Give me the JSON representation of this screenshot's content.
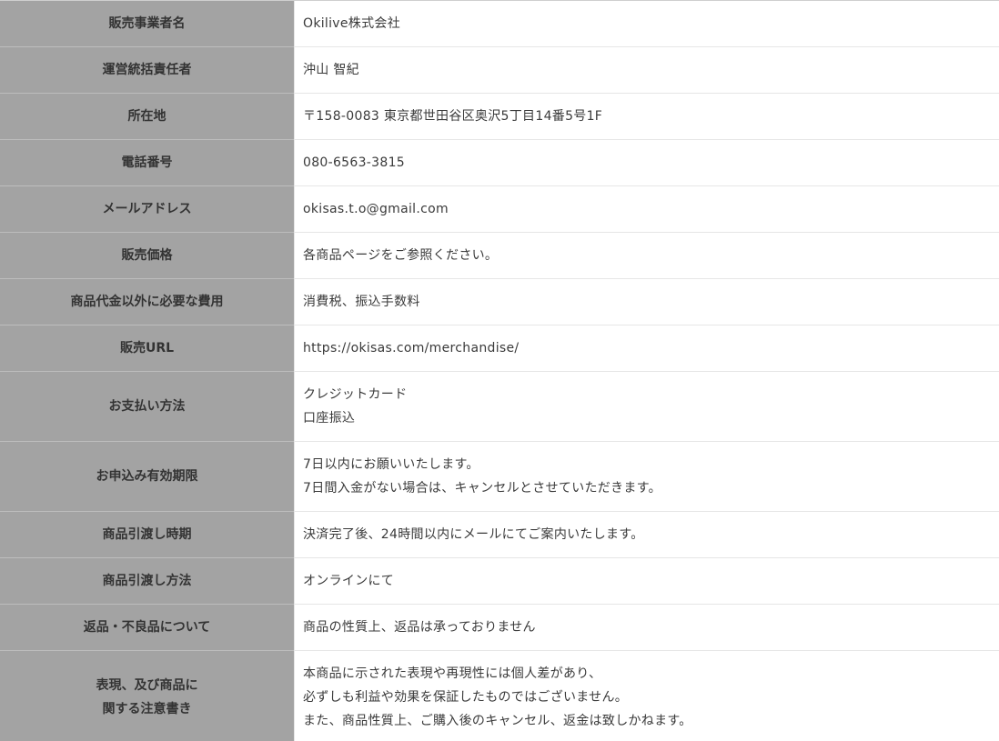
{
  "rows": [
    {
      "label": [
        "販売事業者名"
      ],
      "value": [
        "Okilive株式会社"
      ]
    },
    {
      "label": [
        "運営統括責任者"
      ],
      "value": [
        "沖山 智紀"
      ]
    },
    {
      "label": [
        "所在地"
      ],
      "value": [
        "〒158-0083 東京都世田谷区奥沢5丁目14番5号1F"
      ]
    },
    {
      "label": [
        "電話番号"
      ],
      "value": [
        "080-6563-3815"
      ]
    },
    {
      "label": [
        "メールアドレス"
      ],
      "value": [
        "okisas.t.o@gmail.com"
      ]
    },
    {
      "label": [
        "販売価格"
      ],
      "value": [
        "各商品ページをご参照ください。"
      ]
    },
    {
      "label": [
        "商品代金以外に必要な費用"
      ],
      "value": [
        "消費税、振込手数料"
      ]
    },
    {
      "label": [
        "販売URL"
      ],
      "value": [
        "https://okisas.com/merchandise/"
      ]
    },
    {
      "label": [
        "お支払い方法"
      ],
      "value": [
        "クレジットカード",
        "口座振込"
      ]
    },
    {
      "label": [
        "お申込み有効期限"
      ],
      "value": [
        "7日以内にお願いいたします。",
        "7日間入金がない場合は、キャンセルとさせていただきます。"
      ]
    },
    {
      "label": [
        "商品引渡し時期"
      ],
      "value": [
        "決済完了後、24時間以内にメールにてご案内いたします。"
      ]
    },
    {
      "label": [
        "商品引渡し方法"
      ],
      "value": [
        "オンラインにて"
      ]
    },
    {
      "label": [
        "返品・不良品について"
      ],
      "value": [
        "商品の性質上、返品は承っておりません"
      ]
    },
    {
      "label": [
        "表現、及び商品に",
        "関する注意書き"
      ],
      "value": [
        "本商品に示された表現や再現性には個人差があり、",
        "必ずしも利益や効果を保証したものではございません。",
        "また、商品性質上、ご購入後のキャンセル、返金は致しかねます。"
      ]
    }
  ]
}
